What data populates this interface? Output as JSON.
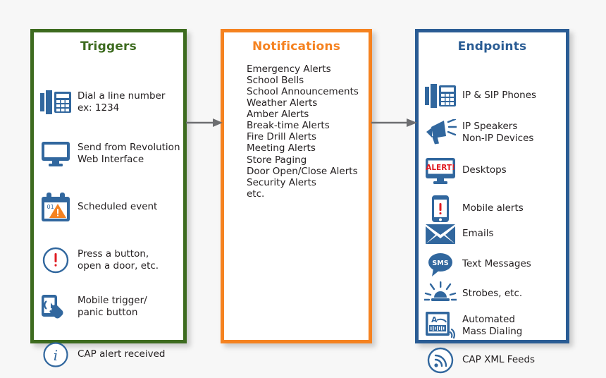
{
  "diagram": {
    "title": "Triggers / Notifications / Endpoints flow",
    "colors": {
      "triggers_border": "#3d6b1f",
      "notifications_border": "#f58220",
      "endpoints_border": "#2a5c94",
      "icon_blue": "#31679e",
      "icon_orange": "#f58220",
      "alert_red": "#e01b22",
      "arrow_gray": "#6d6e71",
      "text": "#231f20",
      "background": "#f7f7f7"
    }
  },
  "triggers": {
    "title": "Triggers",
    "items": [
      {
        "icon": "desk-phone-icon",
        "label": "Dial a line number\nex: 1234"
      },
      {
        "icon": "desktop-monitor-icon",
        "label": "Send from Revolution\nWeb Interface"
      },
      {
        "icon": "calendar-warning-icon",
        "label": "Scheduled event"
      },
      {
        "icon": "exclamation-circle-icon",
        "label": "Press a button,\nopen a door, etc."
      },
      {
        "icon": "mobile-tap-icon",
        "label": "Mobile trigger/\npanic button"
      },
      {
        "icon": "info-circle-icon",
        "label": "CAP alert received"
      }
    ]
  },
  "notifications": {
    "title": "Notifications",
    "items": [
      "Emergency Alerts",
      "School Bells",
      "School Announcements",
      "Weather Alerts",
      "Amber Alerts",
      "Break-time Alerts",
      "Fire Drill Alerts",
      "Meeting Alerts",
      "Store Paging",
      "Door Open/Close Alerts",
      "Security Alerts",
      "etc."
    ]
  },
  "endpoints": {
    "title": "Endpoints",
    "items": [
      {
        "icon": "desk-phone-icon",
        "label": "IP & SIP Phones"
      },
      {
        "icon": "megaphone-icon",
        "label": "IP Speakers\nNon-IP Devices"
      },
      {
        "icon": "desktop-alert-icon",
        "label": "Desktops",
        "badge": "ALERT!"
      },
      {
        "icon": "mobile-alert-icon",
        "label": "Mobile alerts"
      },
      {
        "icon": "envelope-icon",
        "label": "Emails"
      },
      {
        "icon": "sms-bubble-icon",
        "label": "Text Messages",
        "badge": "SMS"
      },
      {
        "icon": "strobe-light-icon",
        "label": "Strobes, etc."
      },
      {
        "icon": "mass-dialing-icon",
        "label": "Automated\nMass Dialing",
        "badge": "A"
      },
      {
        "icon": "rss-feed-icon",
        "label": "CAP XML Feeds"
      }
    ]
  },
  "arrows": [
    {
      "name": "arrow-triggers-to-notifications"
    },
    {
      "name": "arrow-notifications-to-endpoints"
    }
  ]
}
